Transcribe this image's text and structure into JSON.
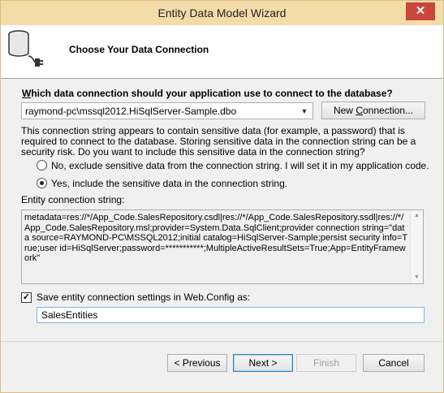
{
  "window": {
    "title": "Entity Data Model Wizard",
    "close_glyph": "✕"
  },
  "header": {
    "title": "Choose Your Data Connection",
    "icon": "database-plug-icon"
  },
  "connection": {
    "question_prefix": "W",
    "question_rest": "hich data connection should your application use to connect to the database?",
    "selected": "raymond-pc\\mssql2012.HiSqlServer-Sample.dbo",
    "new_connection_prefix": "New ",
    "new_connection_underlined": "C",
    "new_connection_suffix": "onnection..."
  },
  "sensitive": {
    "warning": "This connection string appears to contain sensitive data (for example, a password) that is required to connect to the database. Storing sensitive data in the connection string can be a security risk. Do you want to include this sensitive data in the connection string?",
    "option_exclude": "No, exclude sensitive data from the connection string. I will set it in my application code.",
    "option_include": "Yes, include the sensitive data in the connection string.",
    "selected": "include"
  },
  "entity_connection": {
    "label": "Entity connection string:",
    "value": "metadata=res://*/App_Code.SalesRepository.csdl|res://*/App_Code.SalesRepository.ssdl|res://*/App_Code.SalesRepository.msl;provider=System.Data.SqlClient;provider connection string=\"data source=RAYMOND-PC\\MSSQL2012;initial catalog=HiSqlServer-Sample;persist security info=True;user id=HiSqlServer;password=***********;MultipleActiveResultSets=True;App=EntityFramework\""
  },
  "save_settings": {
    "checked": true,
    "label": "Save entity connection settings in Web.Config as:",
    "value": "SalesEntities"
  },
  "buttons": {
    "previous": "< Previous",
    "next": "Next >",
    "finish": "Finish",
    "cancel": "Cancel"
  }
}
